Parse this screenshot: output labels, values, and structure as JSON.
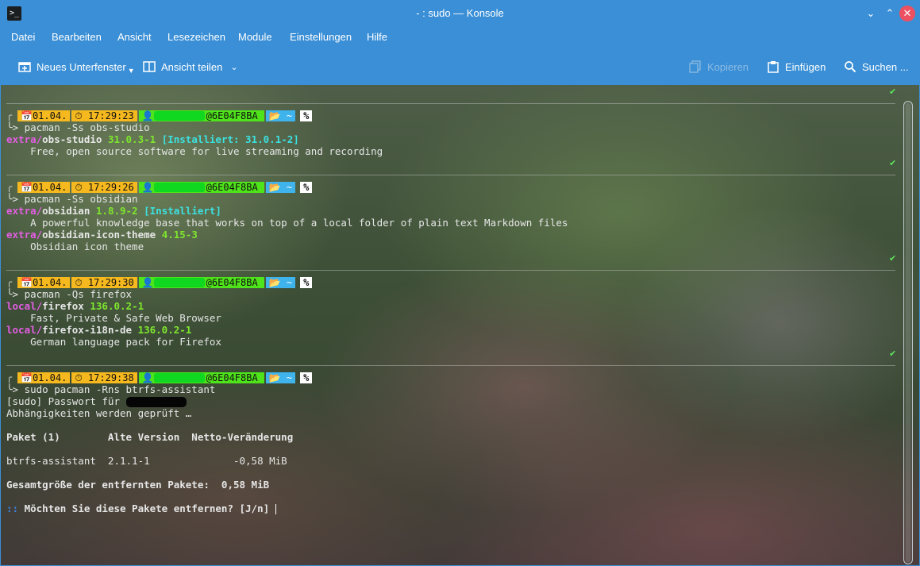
{
  "window": {
    "title": "- : sudo — Konsole",
    "icon": "terminal-icon"
  },
  "menu": [
    "Datei",
    "Bearbeiten",
    "Ansicht",
    "Lesezeichen",
    "Module",
    "Einstellungen",
    "Hilfe"
  ],
  "toolbar": {
    "new_tab": "Neues Unterfenster",
    "split_view": "Ansicht teilen",
    "copy": "Kopieren",
    "paste": "Einfügen",
    "find": "Suchen ..."
  },
  "prompts": [
    {
      "date": "01.04.",
      "time": "17:29:23",
      "host": "@6E04F8BA",
      "dir": "~",
      "status": "%",
      "command": "pacman -Ss obs-studio"
    },
    {
      "date": "01.04.",
      "time": "17:29:26",
      "host": "@6E04F8BA",
      "dir": "~",
      "status": "%",
      "command": "pacman -Ss obsidian"
    },
    {
      "date": "01.04.",
      "time": "17:29:30",
      "host": "@6E04F8BA",
      "dir": "~",
      "status": "%",
      "command": "pacman -Qs firefox"
    },
    {
      "date": "01.04.",
      "time": "17:29:38",
      "host": "@6E04F8BA",
      "dir": "~",
      "status": "%",
      "command": "sudo pacman -Rns btrfs-assistant"
    }
  ],
  "output": {
    "obs": {
      "repo": "extra/",
      "name": "obs-studio",
      "version": "31.0.3-1",
      "installed": "[Installiert: 31.0.1-2]",
      "desc": "    Free, open source software for live streaming and recording"
    },
    "obsidian": {
      "repo": "extra/",
      "name": "obsidian",
      "version": "1.8.9-2",
      "installed": "[Installiert]",
      "desc": "    A powerful knowledge base that works on top of a local folder of plain text Markdown files"
    },
    "obsidian_theme": {
      "repo": "extra/",
      "name": "obsidian-icon-theme",
      "version": "4.15-3",
      "desc": "    Obsidian icon theme"
    },
    "firefox": {
      "repo": "local/",
      "name": "firefox",
      "version": "136.0.2-1",
      "desc": "    Fast, Private & Safe Web Browser"
    },
    "firefox_de": {
      "repo": "local/",
      "name": "firefox-i18n-de",
      "version": "136.0.2-1",
      "desc": "    German language pack for Firefox"
    },
    "sudo_pw": "[sudo] Passwort für ",
    "deps": "Abhängigkeiten werden geprüft …",
    "table_header": "Paket (1)        Alte Version  Netto-Veränderung",
    "table_row": "btrfs-assistant  2.1.1-1              -0,58 MiB",
    "total": "Gesamtgröße der entfernten Pakete:  0,58 MiB",
    "question_prefix": "::",
    "question": " Möchten Sie diese Pakete entfernen? [J/n] "
  },
  "icons": {
    "date": "calendar-icon",
    "time": "clock-icon",
    "user": "user-icon",
    "dir": "folder-icon",
    "check": "checkmark-icon"
  },
  "colors": {
    "accent": "#3a8fd6",
    "prompt_yellow": "#f5b81e",
    "prompt_green": "#4ee31a",
    "prompt_blue": "#3fb3ec",
    "repo_pink": "#e45ee4",
    "version_green": "#7ee62e",
    "installed_cyan": "#3ce0e0"
  }
}
